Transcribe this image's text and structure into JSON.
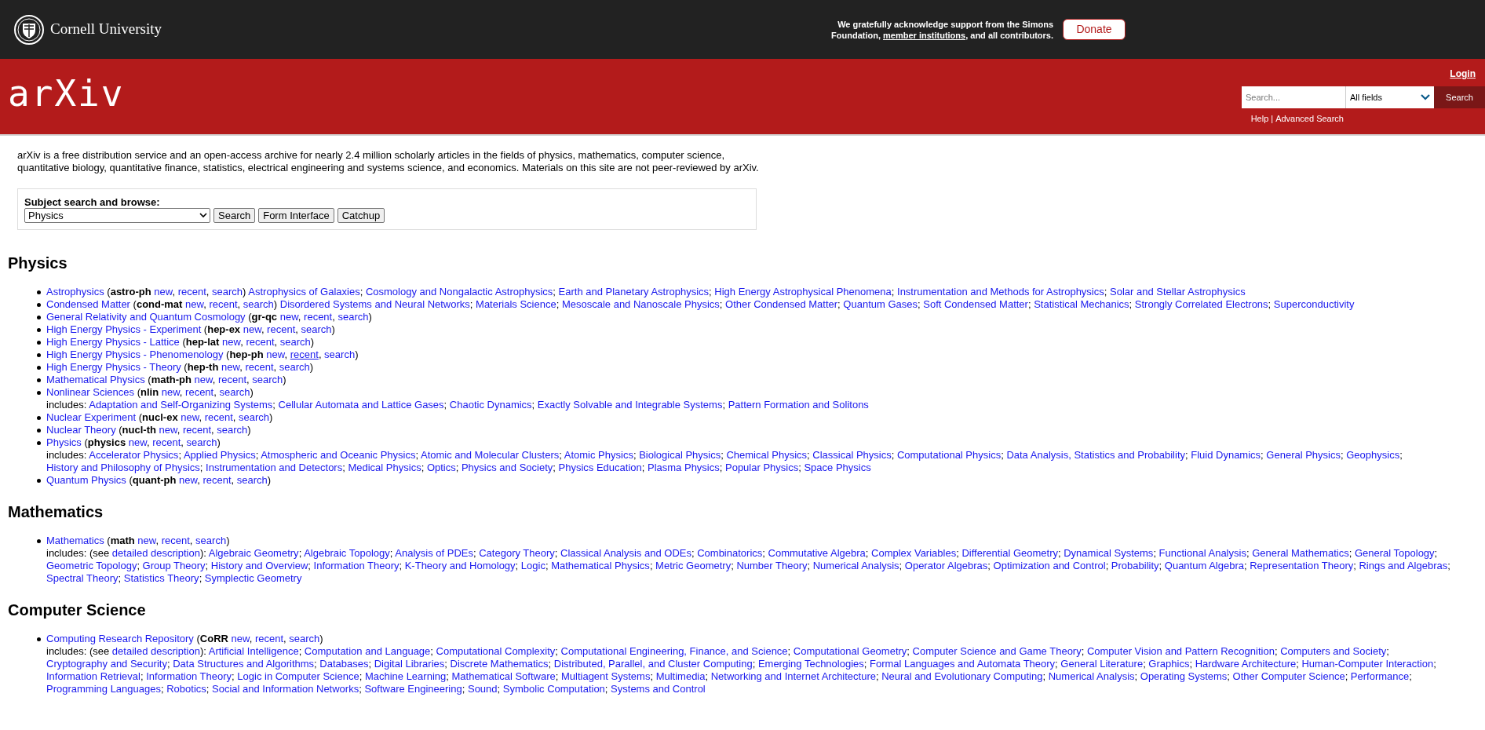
{
  "top_bar": {
    "university": "Cornell University",
    "acknowledgement": {
      "before": "We gratefully acknowledge support from the Simons Foundation,",
      "link": "member institutions",
      "after": ", and all contributors."
    },
    "donate": "Donate"
  },
  "header": {
    "logo": "arXiv",
    "login": "Login",
    "search": {
      "placeholder": "Search...",
      "field": "All fields",
      "button": "Search"
    },
    "help": "Help",
    "divider": "|",
    "advanced": "Advanced Search"
  },
  "intro": "arXiv is a free distribution service and an open-access archive for nearly 2.4 million scholarly articles in the fields of physics, mathematics, computer science, quantitative biology, quantitative finance, statistics, electrical engineering and systems science, and economics. Materials on this site are not peer-reviewed by arXiv.",
  "subject_search": {
    "label": "Subject search and browse:",
    "value": "Physics",
    "buttons": [
      "Search",
      "Form Interface",
      "Catchup"
    ]
  },
  "punctuation": {
    "open": "(",
    "close": ")",
    "comma": ",",
    "semicolon": ";"
  },
  "sections": [
    {
      "title": "Physics",
      "items": [
        {
          "name": "Astrophysics",
          "code": "astro-ph",
          "links": [
            {
              "text": "new",
              "hovered": false
            },
            {
              "text": "recent",
              "hovered": false
            },
            {
              "text": "search",
              "hovered": false
            }
          ],
          "subjects": [
            "Astrophysics of Galaxies",
            "Cosmology and Nongalactic Astrophysics",
            "Earth and Planetary Astrophysics",
            "High Energy Astrophysical Phenomena",
            "Instrumentation and Methods for Astrophysics",
            "Solar and Stellar Astrophysics"
          ]
        },
        {
          "name": "Condensed Matter",
          "code": "cond-mat",
          "links": [
            {
              "text": "new",
              "hovered": false
            },
            {
              "text": "recent",
              "hovered": false
            },
            {
              "text": "search",
              "hovered": false
            }
          ],
          "subjects": [
            "Disordered Systems and Neural Networks",
            "Materials Science",
            "Mesoscale and Nanoscale Physics",
            "Other Condensed Matter",
            "Quantum Gases",
            "Soft Condensed Matter",
            "Statistical Mechanics",
            "Strongly Correlated Electrons",
            "Superconductivity"
          ]
        },
        {
          "name": "General Relativity and Quantum Cosmology",
          "code": "gr-qc",
          "links": [
            {
              "text": "new",
              "hovered": false
            },
            {
              "text": "recent",
              "hovered": false
            },
            {
              "text": "search",
              "hovered": false
            }
          ]
        },
        {
          "name": "High Energy Physics - Experiment",
          "code": "hep-ex",
          "links": [
            {
              "text": "new",
              "hovered": false
            },
            {
              "text": "recent",
              "hovered": false
            },
            {
              "text": "search",
              "hovered": false
            }
          ]
        },
        {
          "name": "High Energy Physics - Lattice",
          "code": "hep-lat",
          "links": [
            {
              "text": "new",
              "hovered": false
            },
            {
              "text": "recent",
              "hovered": false
            },
            {
              "text": "search",
              "hovered": false
            }
          ]
        },
        {
          "name": "High Energy Physics - Phenomenology",
          "code": "hep-ph",
          "links": [
            {
              "text": "new",
              "hovered": false
            },
            {
              "text": "recent",
              "hovered": true
            },
            {
              "text": "search",
              "hovered": false
            }
          ]
        },
        {
          "name": "High Energy Physics - Theory",
          "code": "hep-th",
          "links": [
            {
              "text": "new",
              "hovered": false
            },
            {
              "text": "recent",
              "hovered": false
            },
            {
              "text": "search",
              "hovered": false
            }
          ]
        },
        {
          "name": "Mathematical Physics",
          "code": "math-ph",
          "links": [
            {
              "text": "new",
              "hovered": false
            },
            {
              "text": "recent",
              "hovered": false
            },
            {
              "text": "search",
              "hovered": false
            }
          ]
        },
        {
          "name": "Nonlinear Sciences",
          "code": "nlin",
          "links": [
            {
              "text": "new",
              "hovered": false
            },
            {
              "text": "recent",
              "hovered": false
            },
            {
              "text": "search",
              "hovered": false
            }
          ],
          "includes": {
            "label": "includes:",
            "subjects": [
              "Adaptation and Self-Organizing Systems",
              "Cellular Automata and Lattice Gases",
              "Chaotic Dynamics",
              "Exactly Solvable and Integrable Systems",
              "Pattern Formation and Solitons"
            ]
          }
        },
        {
          "name": "Nuclear Experiment",
          "code": "nucl-ex",
          "links": [
            {
              "text": "new",
              "hovered": false
            },
            {
              "text": "recent",
              "hovered": false
            },
            {
              "text": "search",
              "hovered": false
            }
          ]
        },
        {
          "name": "Nuclear Theory",
          "code": "nucl-th",
          "links": [
            {
              "text": "new",
              "hovered": false
            },
            {
              "text": "recent",
              "hovered": false
            },
            {
              "text": "search",
              "hovered": false
            }
          ]
        },
        {
          "name": "Physics",
          "code": "physics",
          "links": [
            {
              "text": "new",
              "hovered": false
            },
            {
              "text": "recent",
              "hovered": false
            },
            {
              "text": "search",
              "hovered": false
            }
          ],
          "includes": {
            "label": "includes:",
            "subjects": [
              "Accelerator Physics",
              "Applied Physics",
              "Atmospheric and Oceanic Physics",
              "Atomic and Molecular Clusters",
              "Atomic Physics",
              "Biological Physics",
              "Chemical Physics",
              "Classical Physics",
              "Computational Physics",
              "Data Analysis, Statistics and Probability",
              "Fluid Dynamics",
              "General Physics",
              "Geophysics",
              "History and Philosophy of Physics",
              "Instrumentation and Detectors",
              "Medical Physics",
              "Optics",
              "Physics and Society",
              "Physics Education",
              "Plasma Physics",
              "Popular Physics",
              "Space Physics"
            ]
          }
        },
        {
          "name": "Quantum Physics",
          "code": "quant-ph",
          "links": [
            {
              "text": "new",
              "hovered": false
            },
            {
              "text": "recent",
              "hovered": false
            },
            {
              "text": "search",
              "hovered": false
            }
          ]
        }
      ]
    },
    {
      "title": "Mathematics",
      "items": [
        {
          "name": "Mathematics",
          "code": "math",
          "links": [
            {
              "text": "new",
              "hovered": false
            },
            {
              "text": "recent",
              "hovered": false
            },
            {
              "text": "search",
              "hovered": false
            }
          ],
          "includes": {
            "label": "includes: (see",
            "detail_link": "detailed description",
            "after": "):",
            "subjects": [
              "Algebraic Geometry",
              "Algebraic Topology",
              "Analysis of PDEs",
              "Category Theory",
              "Classical Analysis and ODEs",
              "Combinatorics",
              "Commutative Algebra",
              "Complex Variables",
              "Differential Geometry",
              "Dynamical Systems",
              "Functional Analysis",
              "General Mathematics",
              "General Topology",
              "Geometric Topology",
              "Group Theory",
              "History and Overview",
              "Information Theory",
              "K-Theory and Homology",
              "Logic",
              "Mathematical Physics",
              "Metric Geometry",
              "Number Theory",
              "Numerical Analysis",
              "Operator Algebras",
              "Optimization and Control",
              "Probability",
              "Quantum Algebra",
              "Representation Theory",
              "Rings and Algebras",
              "Spectral Theory",
              "Statistics Theory",
              "Symplectic Geometry"
            ]
          }
        }
      ]
    },
    {
      "title": "Computer Science",
      "items": [
        {
          "name": "Computing Research Repository",
          "code": "CoRR",
          "links": [
            {
              "text": "new",
              "hovered": false
            },
            {
              "text": "recent",
              "hovered": false
            },
            {
              "text": "search",
              "hovered": false
            }
          ],
          "includes": {
            "label": "includes: (see",
            "detail_link": "detailed description",
            "after": "):",
            "subjects": [
              "Artificial Intelligence",
              "Computation and Language",
              "Computational Complexity",
              "Computational Engineering, Finance, and Science",
              "Computational Geometry",
              "Computer Science and Game Theory",
              "Computer Vision and Pattern Recognition",
              "Computers and Society",
              "Cryptography and Security",
              "Data Structures and Algorithms",
              "Databases",
              "Digital Libraries",
              "Discrete Mathematics",
              "Distributed, Parallel, and Cluster Computing",
              "Emerging Technologies",
              "Formal Languages and Automata Theory",
              "General Literature",
              "Graphics",
              "Hardware Architecture",
              "Human-Computer Interaction",
              "Information Retrieval",
              "Information Theory",
              "Logic in Computer Science",
              "Machine Learning",
              "Mathematical Software",
              "Multiagent Systems",
              "Multimedia",
              "Networking and Internet Architecture",
              "Neural and Evolutionary Computing",
              "Numerical Analysis",
              "Operating Systems",
              "Other Computer Science",
              "Performance",
              "Programming Languages",
              "Robotics",
              "Social and Information Networks",
              "Software Engineering",
              "Sound",
              "Symbolic Computation",
              "Systems and Control"
            ]
          }
        }
      ]
    }
  ]
}
